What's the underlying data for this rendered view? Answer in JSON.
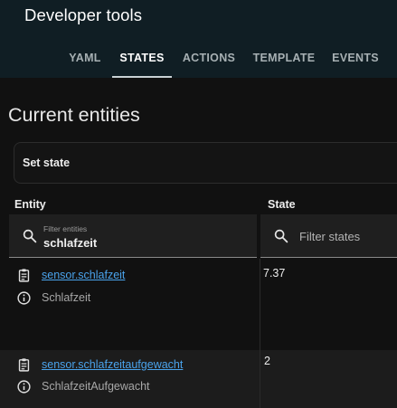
{
  "app": {
    "title": "Developer tools"
  },
  "tabs": [
    {
      "label": "YAML",
      "active": false
    },
    {
      "label": "STATES",
      "active": true
    },
    {
      "label": "ACTIONS",
      "active": false
    },
    {
      "label": "TEMPLATE",
      "active": false
    },
    {
      "label": "EVENTS",
      "active": false
    }
  ],
  "page": {
    "title": "Current entities"
  },
  "set_state": {
    "label": "Set state"
  },
  "table": {
    "headers": {
      "entity": "Entity",
      "state": "State"
    },
    "entity_filter": {
      "label": "Filter entities",
      "value": "schlafzeit"
    },
    "state_filter": {
      "placeholder": "Filter states"
    },
    "rows": [
      {
        "entity_id": "sensor.schlafzeit",
        "friendly_name": "Schlafzeit",
        "state": "7.37"
      },
      {
        "entity_id": "sensor.schlafzeitaufgewacht",
        "friendly_name": "SchlafzeitAufgewacht",
        "state": "2"
      }
    ]
  },
  "icons": {
    "search": "magnify-icon",
    "copy": "clipboard-list-icon",
    "info": "information-outline-icon"
  },
  "colors": {
    "header_bg": "#101e24",
    "link": "#4aa3ec",
    "background": "#111111",
    "row_alt": "#1c1c1c"
  }
}
